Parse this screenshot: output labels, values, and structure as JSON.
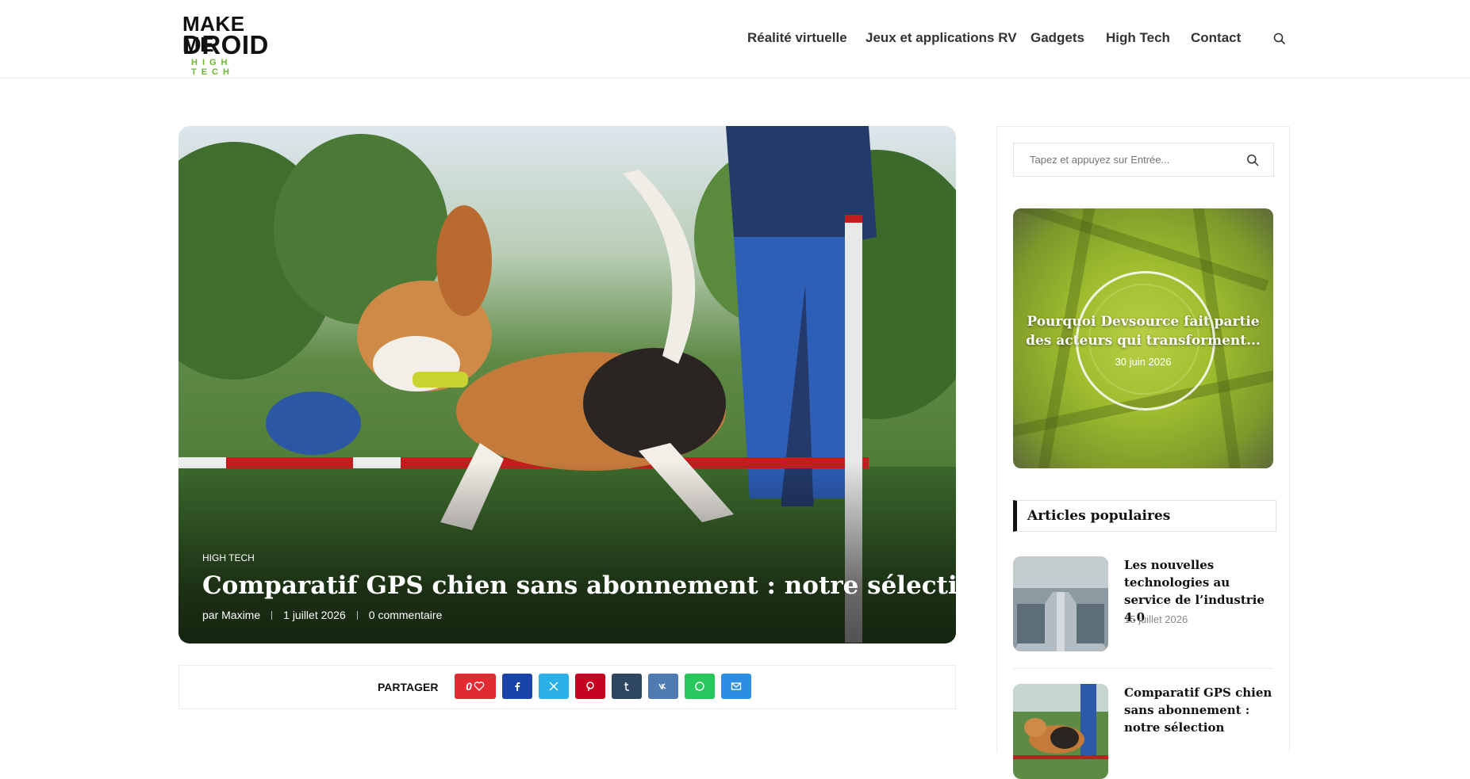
{
  "logo": {
    "line1": "MAKE ME",
    "line2": "DROID",
    "line3": "HIGH TECH"
  },
  "nav": {
    "items": [
      "Réalité virtuelle",
      "Jeux et applications RV",
      "Gadgets",
      "High Tech",
      "Contact"
    ]
  },
  "hero": {
    "category": "HIGH TECH",
    "title": "Comparatif GPS chien sans abonnement : notre sélection",
    "author": "par Maxime",
    "date": "1 juillet 2026",
    "comments": "0 commentaire"
  },
  "share": {
    "label": "PARTAGER",
    "like_count": "0",
    "buttons": [
      {
        "name": "love-button",
        "color": "#e12a32"
      },
      {
        "name": "facebook-share-button",
        "color": "#1a44a8"
      },
      {
        "name": "x-share-button",
        "color": "#2bb0ea"
      },
      {
        "name": "pinterest-share-button",
        "color": "#c6001f"
      },
      {
        "name": "tumblr-share-button",
        "color": "#2f4661"
      },
      {
        "name": "vk-share-button",
        "color": "#4d7bb2"
      },
      {
        "name": "whatsapp-share-button",
        "color": "#28c75d"
      },
      {
        "name": "email-share-button",
        "color": "#2c8ee2"
      }
    ]
  },
  "sidebar": {
    "search_placeholder": "Tapez et appuyez sur Entrée...",
    "featured": {
      "title": "Pourquoi Devsource fait partie des acteurs qui transforment...",
      "date": "30 juin 2026"
    },
    "popular_heading": "Articles populaires",
    "popular": [
      {
        "title": "Les nouvelles technologies au service de l’industrie 4.0",
        "date": "15 juillet 2026"
      },
      {
        "title": "Comparatif GPS chien sans abonnement : notre sélection",
        "date": ""
      }
    ]
  },
  "colors": {
    "accent_green": "#6bb82a",
    "text_dark": "#111111"
  }
}
